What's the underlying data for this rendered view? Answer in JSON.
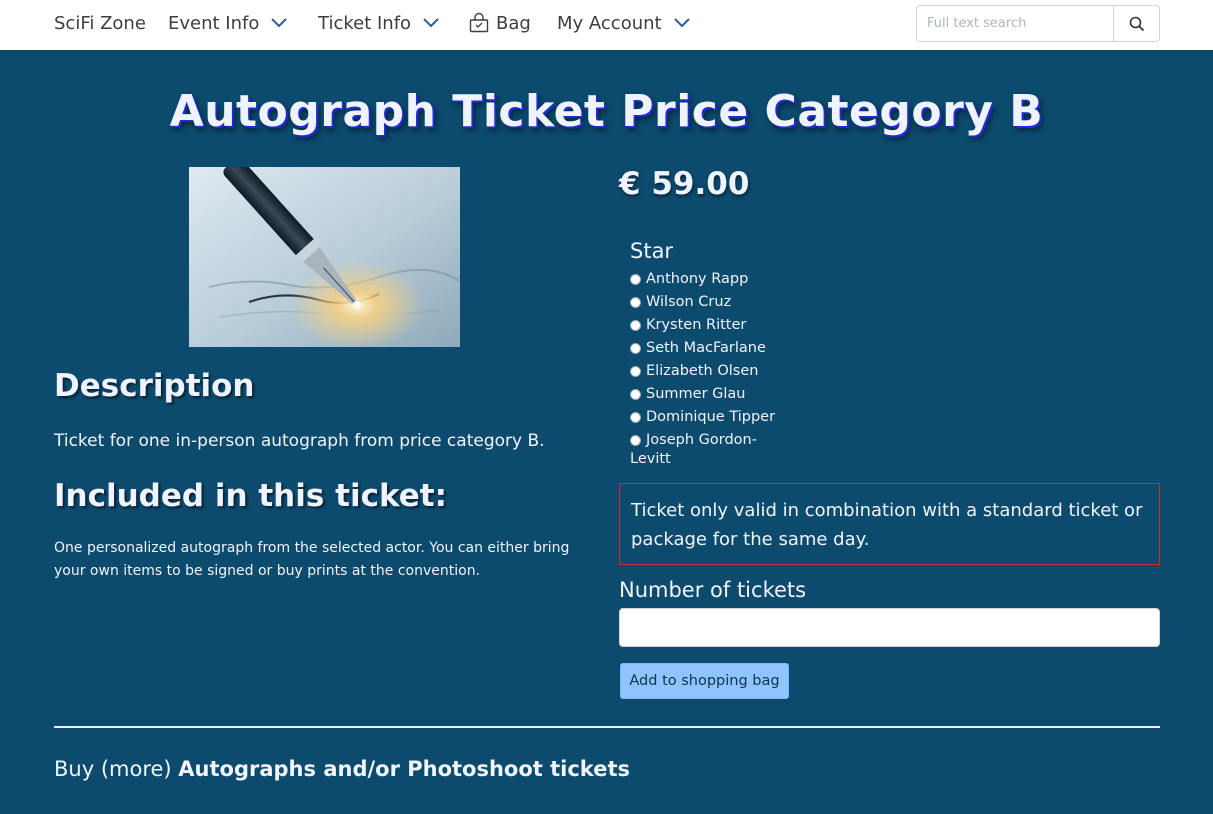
{
  "nav": {
    "brand": "SciFi Zone",
    "event_info": "Event Info",
    "ticket_info": "Ticket Info",
    "bag": "Bag",
    "my_account": "My Account",
    "search_placeholder": "Full text search",
    "icons": {
      "dropdown": "chevron-down-icon",
      "bag": "shopping-bag-icon",
      "search": "search-icon"
    }
  },
  "product": {
    "title": "Autograph Ticket Price Category B",
    "image_alt": "fountain-pen-signing-image",
    "price": "€ 59.00",
    "description_heading": "Description",
    "description": "Ticket for one in-person autograph from price category B.",
    "included_heading": "Included in this ticket:",
    "included_text": "One personalized autograph from the selected actor. You can either bring your own items to be signed or buy prints at the convention."
  },
  "star_selector": {
    "label": "Star",
    "options": [
      "Anthony Rapp",
      "Wilson Cruz",
      "Krysten Ritter",
      "Seth MacFarlane",
      "Elizabeth Olsen",
      "Summer Glau",
      "Dominique Tipper",
      "Joseph Gordon-Levitt"
    ]
  },
  "notice": "Ticket only valid in combination with a standard ticket or package for the same day.",
  "quantity": {
    "label": "Number of tickets",
    "value": ""
  },
  "add_button": "Add to shopping bag",
  "related": {
    "prefix": "Buy (more)",
    "bold": "Autographs and/or Photoshoot tickets"
  },
  "colors": {
    "background": "#0c4a6e",
    "title_shadow": "#1d2bd6",
    "notice_border": "#d42a2a",
    "button": "#8ec5ff",
    "nav_chevron": "#2c5aa0"
  }
}
